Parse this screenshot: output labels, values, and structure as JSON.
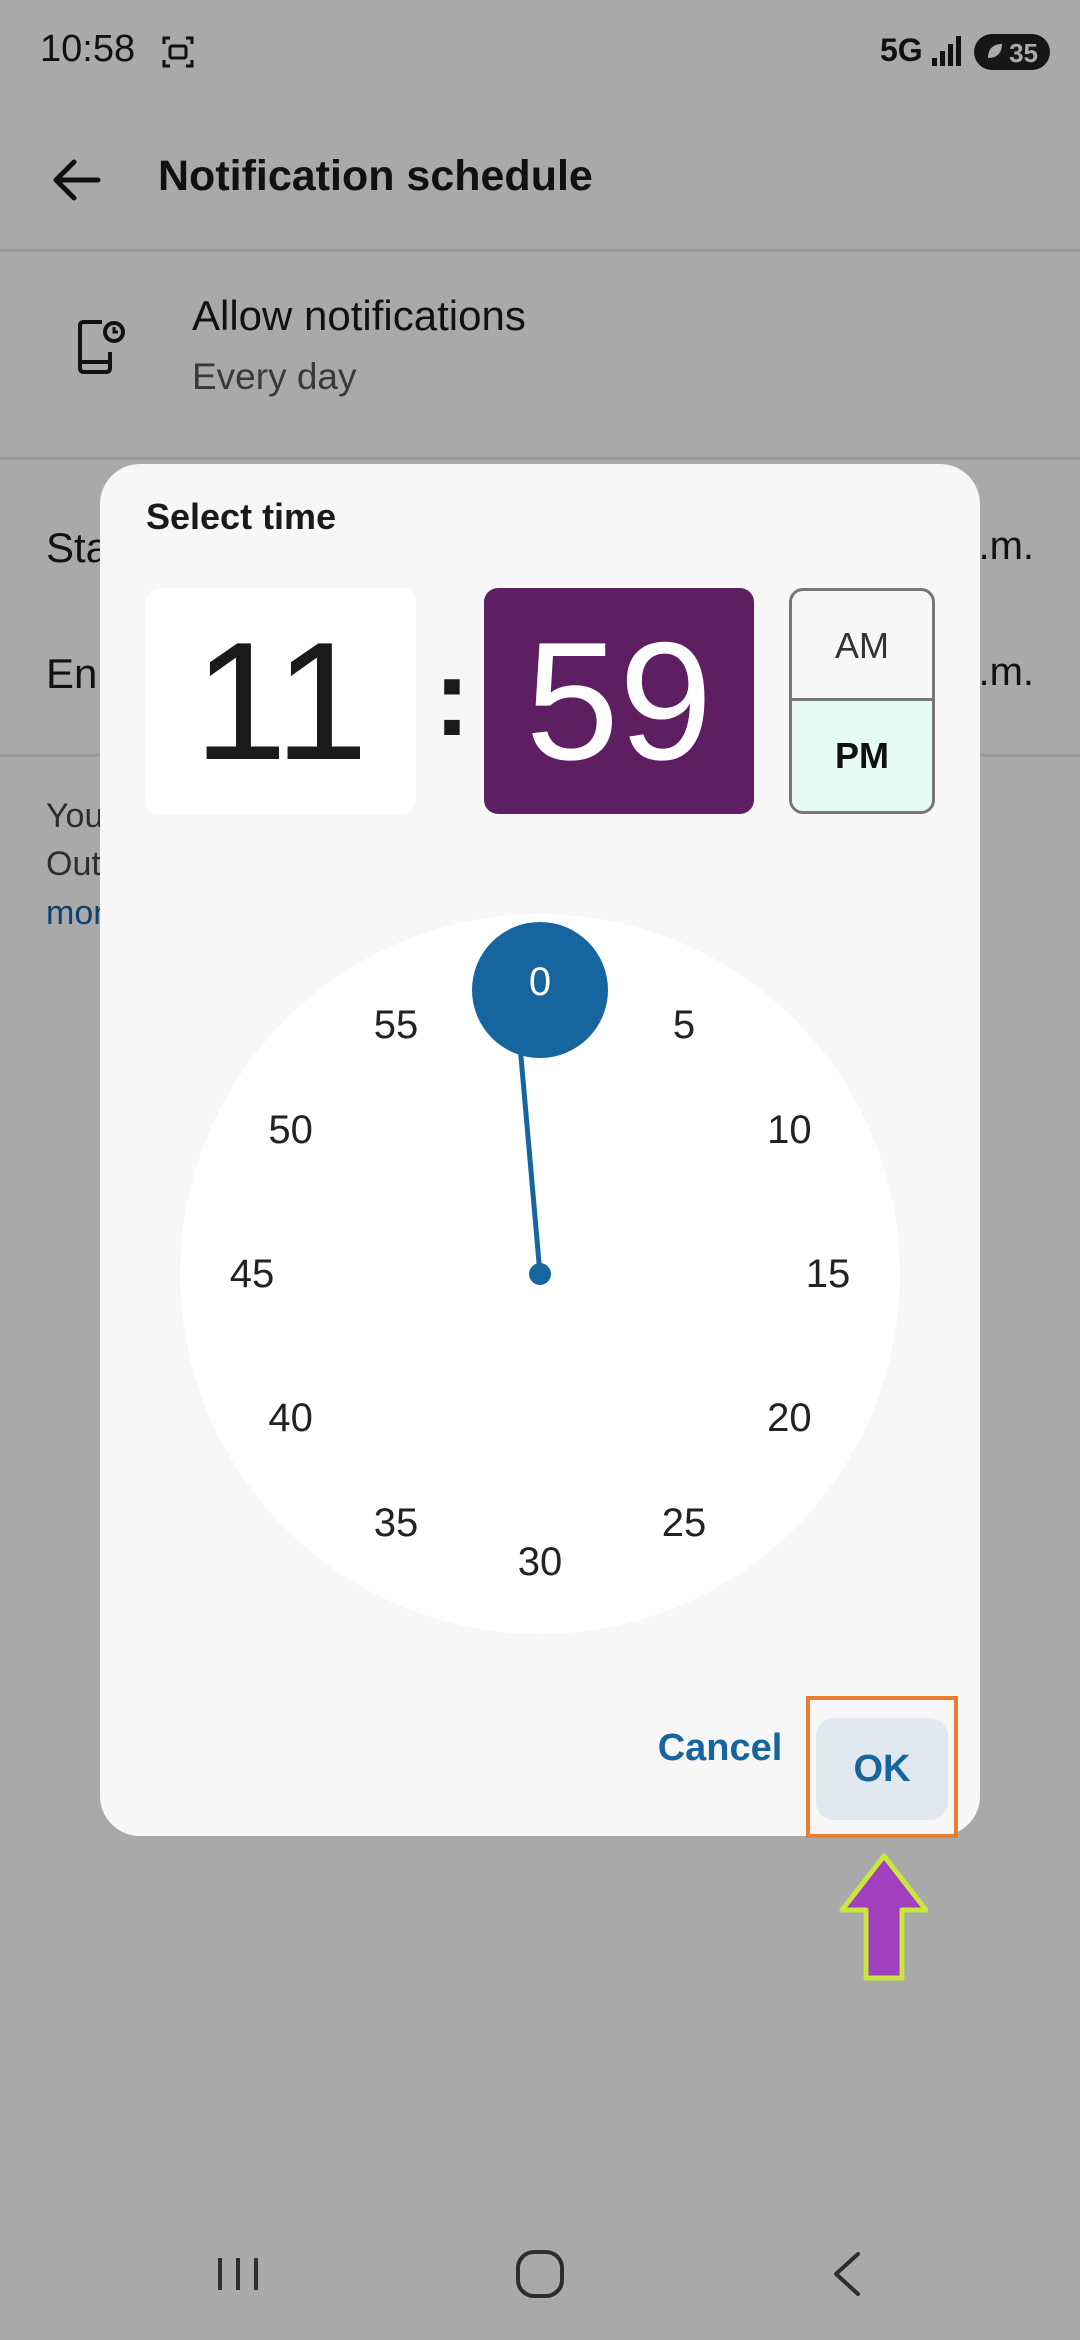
{
  "status_bar": {
    "time": "10:58",
    "network": "5G",
    "battery": "35"
  },
  "app_bar": {
    "title": "Notification schedule"
  },
  "allow_row": {
    "title": "Allow notifications",
    "subtitle": "Every day"
  },
  "background_rows": [
    {
      "label": "Sta",
      "value": "a.m."
    },
    {
      "label": "En",
      "value": "p.m."
    }
  ],
  "info": {
    "line1": "You",
    "line2": "Out",
    "link": "mor"
  },
  "dialog": {
    "title": "Select time",
    "hour": "11",
    "separator": ":",
    "minute": "59",
    "am_label": "AM",
    "pm_label": "PM",
    "selected_period": "PM",
    "dial_labels": [
      "0",
      "5",
      "10",
      "15",
      "20",
      "25",
      "30",
      "35",
      "40",
      "45",
      "50",
      "55"
    ],
    "hand_at": "0",
    "cancel_label": "Cancel",
    "ok_label": "OK"
  },
  "colors": {
    "minute_box": "#5e1f62",
    "pm_selected": "#e6fbf4",
    "accent_blue": "#17659f",
    "highlight_box": "#ec7c2f",
    "arrow_fill": "#a23fbf",
    "arrow_stroke": "#c8e63c"
  },
  "icons": {
    "back": "arrow-left-icon",
    "phone": "phone-clock-icon",
    "screenshot": "screenshot-icon",
    "signal": "signal-icon",
    "battery": "battery-icon",
    "nav_recents": "recents-icon",
    "nav_home": "home-icon",
    "nav_back": "chevron-left-icon"
  }
}
